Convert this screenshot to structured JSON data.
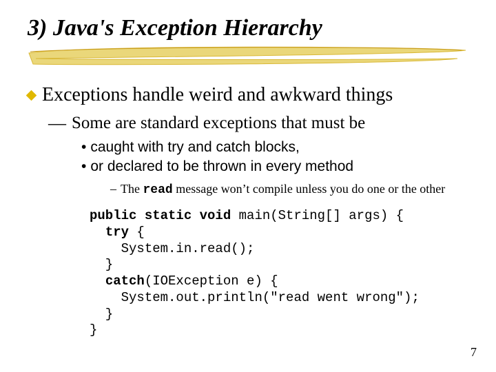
{
  "title": "3) Java's Exception Hierarchy",
  "bullet1": "Exceptions handle weird and awkward things",
  "bullet2": "Some are standard exceptions that must be",
  "bullet3a": "caught with try and catch blocks,",
  "bullet3b": "or declared to be thrown in every method",
  "note_pre": "The ",
  "note_code": "read",
  "note_post": " message won’t compile unless you do one or the other",
  "code": {
    "l1a": "public static void",
    "l1b": " main(String[] args) {",
    "l2a": "try",
    "l2b": " {",
    "l3": "    System.in.read();",
    "l4": "  }",
    "l5a": "catch",
    "l5b": "(IOException e) {",
    "l6": "    System.out.println(\"read went wrong\");",
    "l7": "  }",
    "l8": "}"
  },
  "page": "7"
}
